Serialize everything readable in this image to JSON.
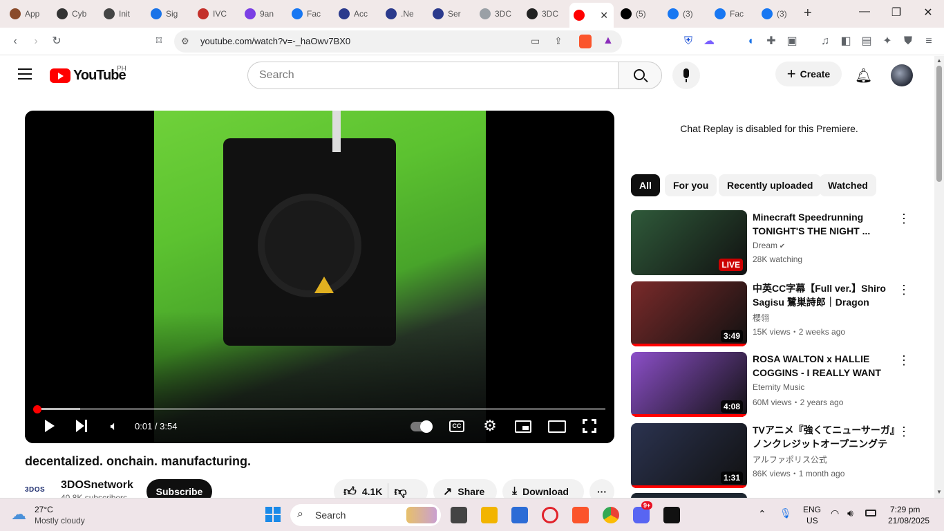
{
  "browser": {
    "tabs": [
      {
        "label": "App",
        "color": "#8a4b2b"
      },
      {
        "label": "Cyb",
        "color": "#333333"
      },
      {
        "label": "Init",
        "color": "#444444"
      },
      {
        "label": "Sig",
        "color": "#1a73e8"
      },
      {
        "label": "IVC",
        "color": "#c4302b"
      },
      {
        "label": "9an",
        "color": "#7b3fe4"
      },
      {
        "label": "Fac",
        "color": "#1877f2"
      },
      {
        "label": "Acc",
        "color": "#2b3a8c"
      },
      {
        "label": ".Ne",
        "color": "#2b3a8c"
      },
      {
        "label": "Ser",
        "color": "#2b3a8c"
      },
      {
        "label": "3DC",
        "color": "#9aa0a6"
      },
      {
        "label": "3DC",
        "color": "#222222"
      },
      {
        "label": "",
        "color": "#ff0000"
      },
      {
        "label": "(5)",
        "color": "#000000"
      },
      {
        "label": "(3)",
        "color": "#1877f2"
      },
      {
        "label": "Fac",
        "color": "#1877f2"
      },
      {
        "label": "(3)",
        "color": "#1877f2"
      }
    ],
    "new_tab": "+",
    "url": "youtube.com/watch?v=-_haOwv7BX0",
    "tab_close": "✕"
  },
  "youtube": {
    "logo": "YouTube",
    "region": "PH",
    "search_placeholder": "Search",
    "create_label": "Create"
  },
  "player": {
    "time": "0:01 / 3:54",
    "progress_fraction": 0.0,
    "buffered_fraction": 0.08
  },
  "video": {
    "title": "decentalized. onchain. manufacturing.",
    "channel": "3DOSnetwork",
    "channel_logo": "3DOS",
    "subscribers": "40.8K subscribers",
    "subscribe_label": "Subscribe",
    "likes": "4.1K",
    "share_label": "Share",
    "download_label": "Download",
    "more_label": "···"
  },
  "sidebar": {
    "chat_replay": "Chat Replay is disabled for this Premiere.",
    "chips": [
      "All",
      "For you",
      "Recently uploaded",
      "Watched"
    ],
    "recommendations": [
      {
        "title": "Minecraft Speedrunning TONIGHT'S THE NIGHT ...",
        "channel": "Dream",
        "meta": "28K watching",
        "badge": "LIVE",
        "verified": true,
        "thumb": "#2f5a3a",
        "watched": false
      },
      {
        "title": "中英CC字幕【Full ver.】Shiro Sagisu 鷺巣詩郎｜Dragon Raja...",
        "channel": "櫻翎",
        "meta": "15K views・2 weeks ago",
        "badge": "3:49",
        "verified": false,
        "thumb": "#7a2a2a",
        "watched": true
      },
      {
        "title": "ROSA WALTON x HALLIE COGGINS - I REALLY WANT TO...",
        "channel": "Eternity Music",
        "meta": "60M views・2 years ago",
        "badge": "4:08",
        "verified": false,
        "thumb": "#8c4fc9",
        "watched": true
      },
      {
        "title": "TVアニメ『強くてニューサーガ』ノンクレジットオープニングテーマ｜...",
        "channel": "アルファポリス公式",
        "meta": "86K views・1 month ago",
        "badge": "1:31",
        "verified": false,
        "thumb": "#2b3350",
        "watched": true
      }
    ],
    "next_title_peek": "ヲ ヲ クロ ラ"
  },
  "taskbar": {
    "weather_temp": "27°C",
    "weather_desc": "Mostly cloudy",
    "search_label": "Search",
    "lang_top": "ENG",
    "lang_bottom": "US",
    "time": "7:29 pm",
    "date": "21/08/2025",
    "discord_badge": "9+"
  }
}
